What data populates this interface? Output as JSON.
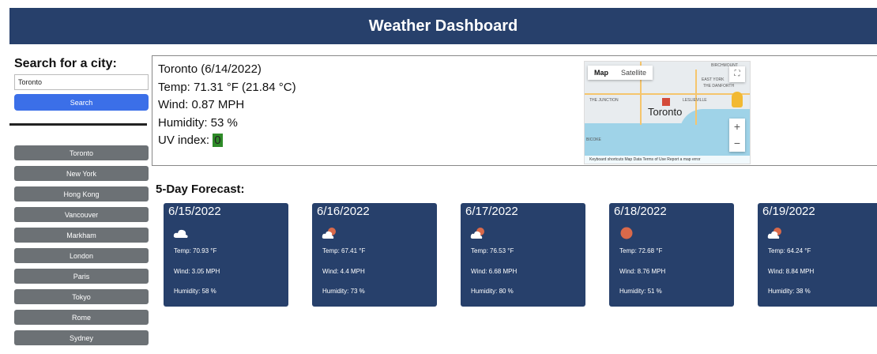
{
  "header": {
    "title": "Weather Dashboard"
  },
  "search": {
    "title": "Search for a city:",
    "value": "Toronto",
    "button_label": "Search"
  },
  "cities": [
    "Toronto",
    "New York",
    "Hong Kong",
    "Vancouver",
    "Markham",
    "London",
    "Paris",
    "Tokyo",
    "Rome",
    "Sydney"
  ],
  "current": {
    "title": "Toronto (6/14/2022)",
    "temp": "Temp: 71.31 °F (21.84 °C)",
    "wind": "Wind: 0.87 MPH",
    "humidity": "Humidity: 53 %",
    "uv_label": "UV index: ",
    "uv_value": "0",
    "uv_color": "#2e8b28"
  },
  "map": {
    "tab_map": "Map",
    "tab_satellite": "Satellite",
    "city_label": "Toronto",
    "zoom_in": "+",
    "zoom_out": "−",
    "labels": [
      "EAST YORK",
      "THE DANFORTH",
      "THE JUNCTION",
      "LESLIEVILLE",
      "BICOKE",
      "BIRCHMOUNT"
    ],
    "footer": "Keyboard shortcuts   Map Data   Terms of Use   Report a map error"
  },
  "forecast": {
    "title": "5-Day Forecast:",
    "days": [
      {
        "date": "6/15/2022",
        "icon": "cloud-icon",
        "temp": "Temp: 70.93 °F",
        "wind": "Wind: 3.05 MPH",
        "humidity": "Humidity: 58 %"
      },
      {
        "date": "6/16/2022",
        "icon": "partly-cloudy-icon",
        "temp": "Temp: 67.41 °F",
        "wind": "Wind: 4.4 MPH",
        "humidity": "Humidity: 73 %"
      },
      {
        "date": "6/17/2022",
        "icon": "partly-cloudy-icon",
        "temp": "Temp: 76.53 °F",
        "wind": "Wind: 6.68 MPH",
        "humidity": "Humidity: 80 %"
      },
      {
        "date": "6/18/2022",
        "icon": "sun-icon",
        "temp": "Temp: 72.68 °F",
        "wind": "Wind: 8.76 MPH",
        "humidity": "Humidity: 51 %"
      },
      {
        "date": "6/19/2022",
        "icon": "partly-cloudy-icon",
        "temp": "Temp: 64.24 °F",
        "wind": "Wind: 8.84 MPH",
        "humidity": "Humidity: 38 %"
      }
    ]
  },
  "colors": {
    "header_bg": "#27406b",
    "search_button": "#3b6fe8",
    "city_button": "#6c7175",
    "card_bg": "#27406b",
    "sun": "#d9694a"
  }
}
